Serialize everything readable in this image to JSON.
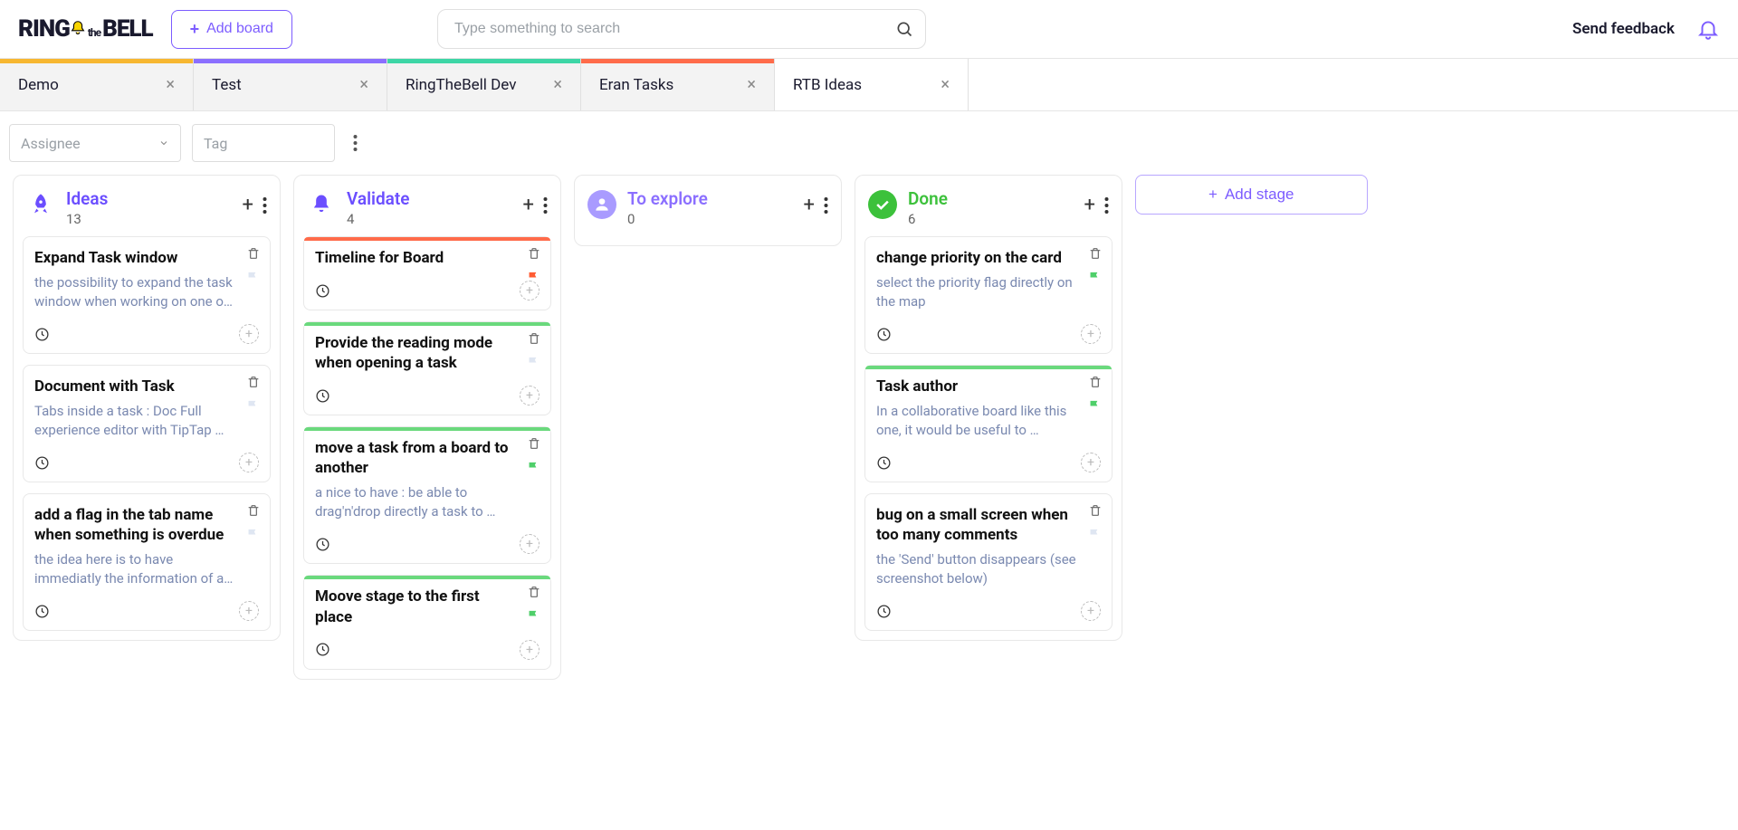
{
  "header": {
    "logo_ring": "RING",
    "logo_the": "the",
    "logo_bell": "BELL",
    "add_board_label": "Add board",
    "search_placeholder": "Type something to search",
    "feedback_label": "Send feedback"
  },
  "tabs": [
    {
      "label": "Demo",
      "color": "#f7b731",
      "active": false
    },
    {
      "label": "Test",
      "color": "#8b6fff",
      "active": false
    },
    {
      "label": "RingTheBell Dev",
      "color": "#3dd6a6",
      "active": false
    },
    {
      "label": "Eran Tasks",
      "color": "#ff6b4a",
      "active": false
    },
    {
      "label": "RTB Ideas",
      "color": "transparent",
      "active": true
    }
  ],
  "filters": {
    "assignee_placeholder": "Assignee",
    "tag_placeholder": "Tag"
  },
  "columns": [
    {
      "title": "Ideas",
      "title_color": "#6b4eff",
      "count": "13",
      "icon": "rocket",
      "icon_bg": "#fff",
      "icon_color": "#6b4eff",
      "cards": [
        {
          "title": "Expand Task window",
          "desc": "the possibility to expand the task window when working on one o…",
          "flag": "#dfe6f2",
          "accent": ""
        },
        {
          "title": "Document with Task",
          "desc": "Tabs inside a task : Doc Full experience editor with TipTap …",
          "flag": "#dfe6f2",
          "accent": ""
        },
        {
          "title": "add a flag in the tab name when something is overdue",
          "desc": "the idea here is to have immediatly the information of a…",
          "flag": "#dfe6f2",
          "accent": ""
        }
      ]
    },
    {
      "title": "Validate",
      "title_color": "#6b4eff",
      "count": "4",
      "icon": "bell",
      "icon_bg": "#fff",
      "icon_color": "#6b4eff",
      "cards": [
        {
          "title": "Timeline for Board",
          "desc": "",
          "flag": "#ff5c33",
          "accent": "#ff6b4a"
        },
        {
          "title": "Provide the reading mode when opening a task",
          "desc": "",
          "flag": "#dfe6f2",
          "accent": "#6ad97d"
        },
        {
          "title": "move a task from a board to another",
          "desc": "a nice to have : be able to drag'n'drop directly a task to …",
          "flag": "#4fcf6a",
          "accent": "#6ad97d"
        },
        {
          "title": "Moove stage to the first place",
          "desc": "",
          "flag": "#4fcf6a",
          "accent": "#6ad97d"
        }
      ]
    },
    {
      "title": "To explore",
      "title_color": "#8b6fff",
      "count": "0",
      "icon": "person",
      "icon_bg": "#a99bff",
      "icon_color": "#fff",
      "cards": []
    },
    {
      "title": "Done",
      "title_color": "#3cc13b",
      "count": "6",
      "icon": "check",
      "icon_bg": "#3cc13b",
      "icon_color": "#fff",
      "cards": [
        {
          "title": "change priority on the card",
          "desc": "select the priority flag directly on the map",
          "flag": "#4fcf6a",
          "accent": ""
        },
        {
          "title": "Task author",
          "desc": "In a collaborative board like this one, it would be useful to …",
          "flag": "#4fcf6a",
          "accent": "#6ad97d"
        },
        {
          "title": "bug on a small screen when too many comments",
          "desc": "the 'Send' button disappears (see screenshot below)",
          "flag": "#dfe6f2",
          "accent": ""
        }
      ]
    }
  ],
  "add_stage_label": "Add stage"
}
